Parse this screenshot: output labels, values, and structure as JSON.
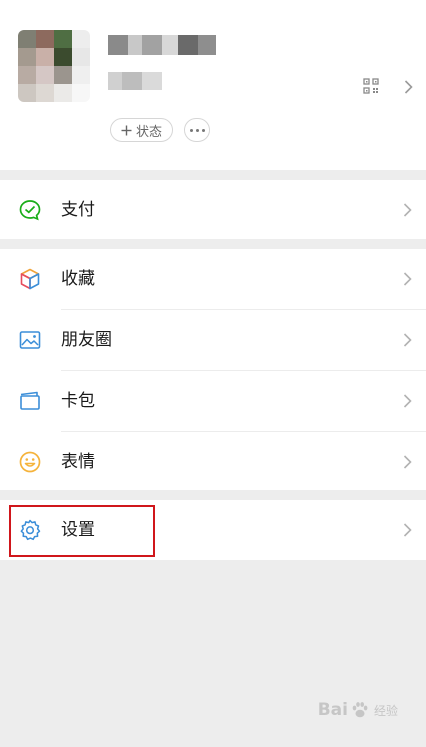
{
  "profile": {
    "status_label": "状态"
  },
  "menu": {
    "pay": "支付",
    "favorites": "收藏",
    "moments": "朋友圈",
    "cards": "卡包",
    "stickers": "表情",
    "settings": "设置"
  },
  "watermark": {
    "brand": "Bai",
    "suffix": "经验"
  },
  "colors": {
    "highlight": "#d0161b",
    "pay_green": "#1aad19",
    "icon_blue": "#3b8ed8",
    "sticker_yellow": "#f5b33b"
  }
}
